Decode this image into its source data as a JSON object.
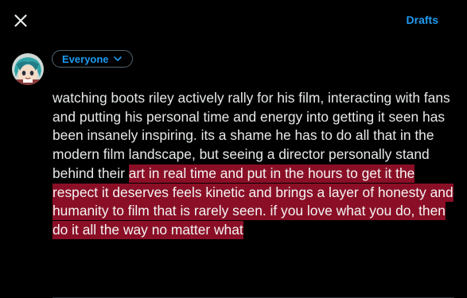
{
  "header": {
    "close_icon": "close-icon",
    "drafts_label": "Drafts"
  },
  "audience": {
    "label": "Everyone",
    "chevron_icon": "chevron-down-icon"
  },
  "composer": {
    "text_plain": "watching boots riley actively rally for his film, interacting with fans and putting his personal time and energy into getting it seen has been insanely inspiring. its a shame he has to do all that in the modern film landscape, but seeing a director personally stand behind their ",
    "text_highlighted": "art in real time and put in the hours to get it the respect it deserves feels kinetic and brings a layer of honesty and humanity to film that is rarely seen. if you love what you do, then do it all the way no matter what"
  },
  "colors": {
    "background": "#000000",
    "accent": "#1d9bf0",
    "text": "#e7e9ea",
    "highlight": "#8a0f26"
  }
}
